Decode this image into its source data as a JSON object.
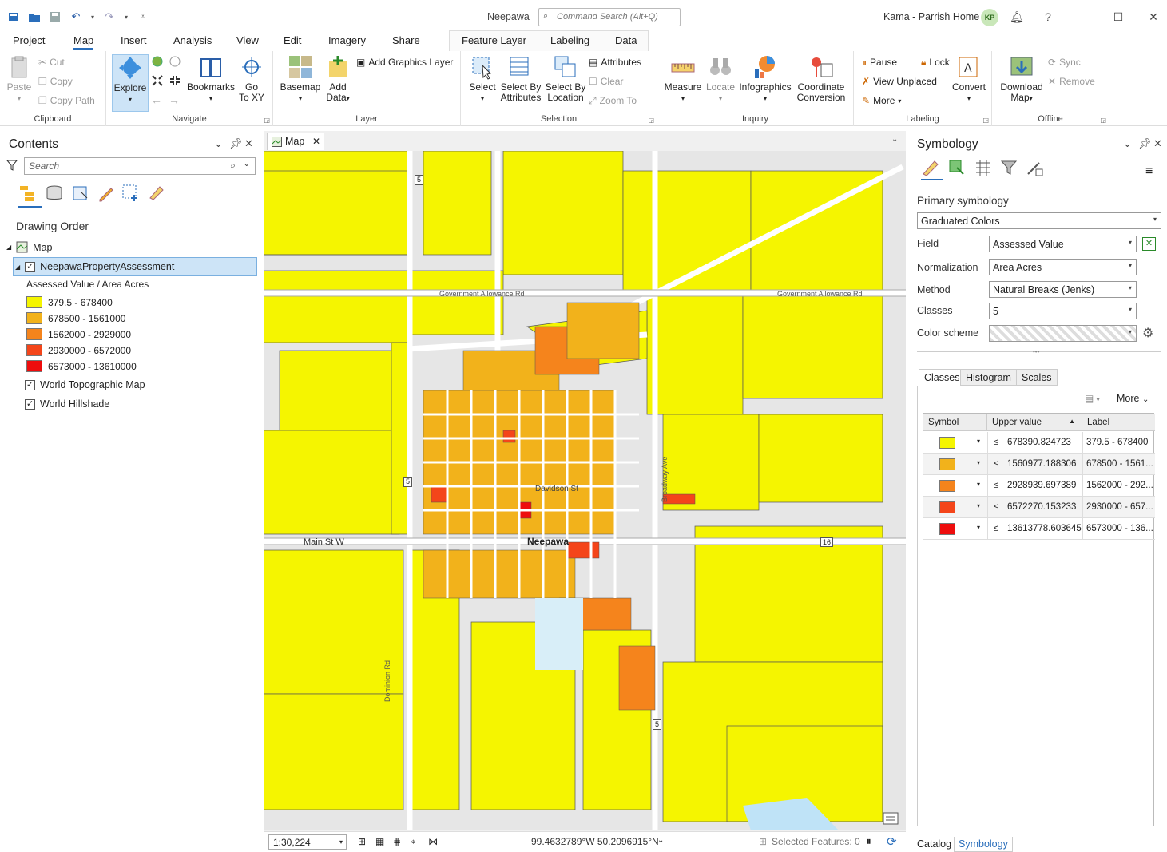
{
  "window": {
    "title": "Neepawa",
    "command_search_placeholder": "Command Search (Alt+Q)",
    "user_name": "Kama - Parrish Home",
    "user_initials": "KP"
  },
  "ribbon_tabs": [
    "Project",
    "Map",
    "Insert",
    "Analysis",
    "View",
    "Edit",
    "Imagery",
    "Share"
  ],
  "context_tabs": [
    "Feature Layer",
    "Labeling",
    "Data"
  ],
  "ribbon": {
    "clipboard": {
      "label": "Clipboard",
      "paste": "Paste",
      "cut": "Cut",
      "copy": "Copy",
      "copy_path": "Copy Path"
    },
    "navigate": {
      "label": "Navigate",
      "explore": "Explore",
      "bookmarks": "Bookmarks",
      "go_to_xy_1": "Go",
      "go_to_xy_2": "To XY"
    },
    "layer": {
      "label": "Layer",
      "basemap": "Basemap",
      "add_data_1": "Add",
      "add_data_2": "Data",
      "add_graphics_layer": "Add Graphics Layer"
    },
    "selection": {
      "label": "Selection",
      "select": "Select",
      "select_by_attr_1": "Select By",
      "select_by_attr_2": "Attributes",
      "select_by_loc_1": "Select By",
      "select_by_loc_2": "Location",
      "attributes": "Attributes",
      "clear": "Clear",
      "zoom_to": "Zoom To"
    },
    "inquiry": {
      "label": "Inquiry",
      "measure": "Measure",
      "locate": "Locate",
      "infographics": "Infographics",
      "coord_conv_1": "Coordinate",
      "coord_conv_2": "Conversion"
    },
    "labeling": {
      "label": "Labeling",
      "pause": "Pause",
      "lock": "Lock",
      "view_unplaced": "View Unplaced",
      "more": "More",
      "convert": "Convert"
    },
    "offline": {
      "label": "Offline",
      "download_map_1": "Download",
      "download_map_2": "Map",
      "sync": "Sync",
      "remove": "Remove"
    }
  },
  "contents": {
    "title": "Contents",
    "search_placeholder": "Search",
    "drawing_order": "Drawing Order",
    "map_node": "Map",
    "layer_name": "NeepawaPropertyAssessment",
    "legend_heading": "Assessed Value / Area Acres",
    "legend": [
      {
        "label": "379.5 - 678400",
        "color": "#f5f500"
      },
      {
        "label": "678500 - 1561000",
        "color": "#f2b21b"
      },
      {
        "label": "1562000 - 2929000",
        "color": "#f5841c"
      },
      {
        "label": "2930000 - 6572000",
        "color": "#f4451a"
      },
      {
        "label": "6573000 - 13610000",
        "color": "#ee0d0d"
      }
    ],
    "basemap_layers": [
      "World Topographic Map",
      "World Hillshade"
    ]
  },
  "map": {
    "tab_label": "Map",
    "place_label": "Neepawa",
    "road_labels": {
      "main_st": "Main St W",
      "gov_allowance_left": "Government Allowance Rd",
      "gov_allowance_right": "Government Allowance Rd",
      "dominion": "Dominion Rd",
      "broadway": "Broadway Ave",
      "davidson": "Davidson St"
    },
    "highway_shields": [
      "5",
      "5",
      "5",
      "16"
    ],
    "scale": "1:30,224",
    "coordinates": "99.4632789°W 50.2096915°N",
    "selected_features": "Selected Features: 0"
  },
  "symbology": {
    "title": "Symbology",
    "primary_label": "Primary symbology",
    "renderer": "Graduated Colors",
    "field_label": "Field",
    "field_value": "Assessed Value",
    "normalization_label": "Normalization",
    "normalization_value": "Area Acres",
    "method_label": "Method",
    "method_value": "Natural Breaks (Jenks)",
    "classes_label": "Classes",
    "classes_value": "5",
    "color_scheme_label": "Color scheme",
    "subtabs": [
      "Classes",
      "Histogram",
      "Scales"
    ],
    "more_label": "More",
    "columns": [
      "Symbol",
      "Upper value",
      "Label"
    ],
    "rows": [
      {
        "color": "#f5f500",
        "le": "≤",
        "upper": "678390.824723",
        "label": "379.5 - 678400"
      },
      {
        "color": "#f2b21b",
        "le": "≤",
        "upper": "1560977.188306",
        "label": "678500 - 1561..."
      },
      {
        "color": "#f5841c",
        "le": "≤",
        "upper": "2928939.697389",
        "label": "1562000 - 292..."
      },
      {
        "color": "#f4451a",
        "le": "≤",
        "upper": "6572270.153233",
        "label": "2930000 - 657..."
      },
      {
        "color": "#ee0d0d",
        "le": "≤",
        "upper": "13613778.603645",
        "label": "6573000 - 136..."
      }
    ],
    "bottom_tabs": [
      "Catalog",
      "Symbology"
    ]
  }
}
